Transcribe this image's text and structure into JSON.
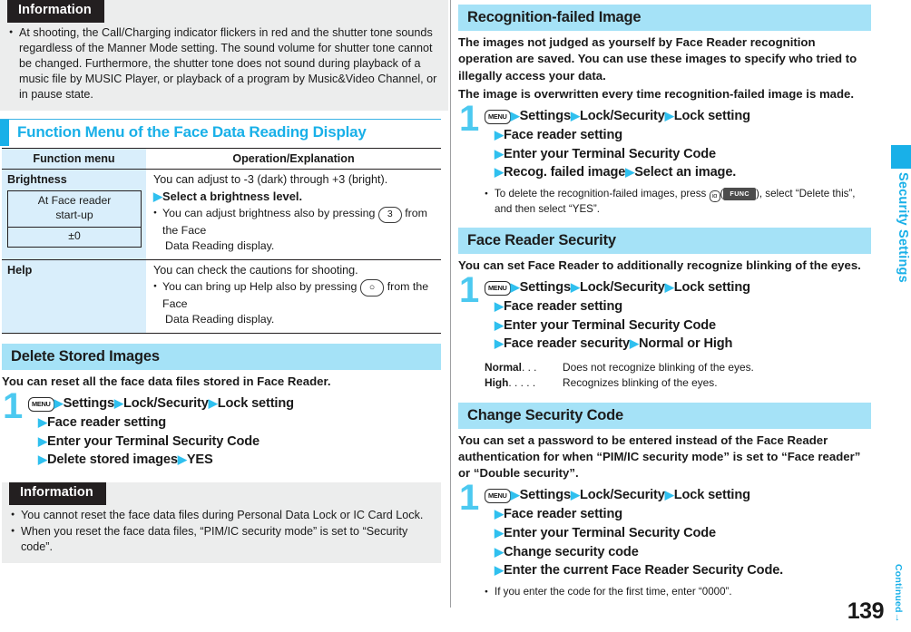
{
  "left": {
    "info_top": {
      "title": "Information",
      "items": [
        "At shooting, the Call/Charging indicator flickers in red and the shutter tone sounds regardless of the Manner Mode setting. The sound volume for shutter tone cannot be changed. Furthermore, the shutter tone does not sound during playback of a music file by MUSIC Player, or playback of a program by Music&Video Channel, or in pause state."
      ]
    },
    "function_menu_section": {
      "heading": "Function Menu of the Face Data Reading Display",
      "table": {
        "headers": [
          "Function menu",
          "Operation/Explanation"
        ],
        "rows": [
          {
            "name": "Brightness",
            "sub": {
              "line1": "At Face reader",
              "line2": "start-up",
              "value": "±0"
            },
            "desc_line1": "You can adjust to -3 (dark) through +3 (bright).",
            "desc_arrow": "Select a brightness level.",
            "note_pre": "You can adjust brightness also by pressing",
            "note_key": "3",
            "note_post": "from the Face",
            "note_line2": "Data Reading display."
          },
          {
            "name": "Help",
            "desc_line1": "You can check the cautions for shooting.",
            "note_pre": "You can bring up Help also by pressing",
            "note_key": "○",
            "note_post": "from the Face",
            "note_line2": "Data Reading display."
          }
        ]
      }
    },
    "delete_section": {
      "heading": "Delete Stored Images",
      "intro": "You can reset all the face data files stored in Face Reader.",
      "step_number": "1",
      "menu_key": "MENU",
      "lines": [
        [
          "Settings",
          "Lock/Security",
          "Lock setting"
        ],
        [
          "Face reader setting"
        ],
        [
          "Enter your Terminal Security Code"
        ],
        [
          "Delete stored images",
          "YES"
        ]
      ]
    },
    "info_bottom": {
      "title": "Information",
      "items": [
        "You cannot reset the face data files during Personal Data Lock or IC Card Lock.",
        "When you reset the face data files, “PIM/IC security mode” is set to “Security code”."
      ]
    }
  },
  "right": {
    "recognition_section": {
      "heading": "Recognition-failed Image",
      "intro_p1": "The images not judged as yourself by Face Reader recognition operation are saved. You can use these images to specify who tried to illegally access your data.",
      "intro_p2": "The image is overwritten every time recognition-failed image is made.",
      "step_number": "1",
      "menu_key": "MENU",
      "lines": [
        [
          "Settings",
          "Lock/Security",
          "Lock setting"
        ],
        [
          "Face reader setting"
        ],
        [
          "Enter your Terminal Security Code"
        ],
        [
          "Recog. failed image",
          "Select an image."
        ]
      ],
      "note_pre": "To delete the recognition-failed images, press",
      "note_key_icon": "iα",
      "note_badge": "FUNC",
      "note_mid": ", select “Delete this”,",
      "note_line2": "and then select “YES”."
    },
    "face_security_section": {
      "heading": "Face Reader Security",
      "intro": "You can set Face Reader to additionally recognize blinking of the eyes.",
      "step_number": "1",
      "menu_key": "MENU",
      "lines": [
        [
          "Settings",
          "Lock/Security",
          "Lock setting"
        ],
        [
          "Face reader setting"
        ],
        [
          "Enter your Terminal Security Code"
        ],
        [
          "Face reader security",
          "Normal or High"
        ]
      ],
      "defs": [
        {
          "term": "Normal",
          "dots": ". . .",
          "desc": "Does not recognize blinking of the eyes."
        },
        {
          "term": "High",
          "dots": ". . . . .",
          "desc": "Recognizes blinking of the eyes."
        }
      ]
    },
    "change_code_section": {
      "heading": "Change Security Code",
      "intro": "You can set a password to be entered instead of the Face Reader authentication for when “PIM/IC security mode” is set to “Face reader” or “Double security”.",
      "step_number": "1",
      "menu_key": "MENU",
      "lines": [
        [
          "Settings",
          "Lock/Security",
          "Lock setting"
        ],
        [
          "Face reader setting"
        ],
        [
          "Enter your Terminal Security Code"
        ],
        [
          "Change security code"
        ],
        [
          "Enter the current Face Reader Security Code."
        ]
      ],
      "note": "If you enter the code for the first time, enter “0000”."
    }
  },
  "edge": {
    "tab_label": "Security Settings"
  },
  "footer": {
    "page_number": "139",
    "continued": "Continued",
    "continued_arrow": "→"
  },
  "colors": {
    "accent_cyan": "#19b0e8",
    "header_band": "#a5e2f7",
    "info_bg": "#eceded",
    "table_col_bg": "#d9eefb",
    "arrow": "#2fc0ef"
  }
}
